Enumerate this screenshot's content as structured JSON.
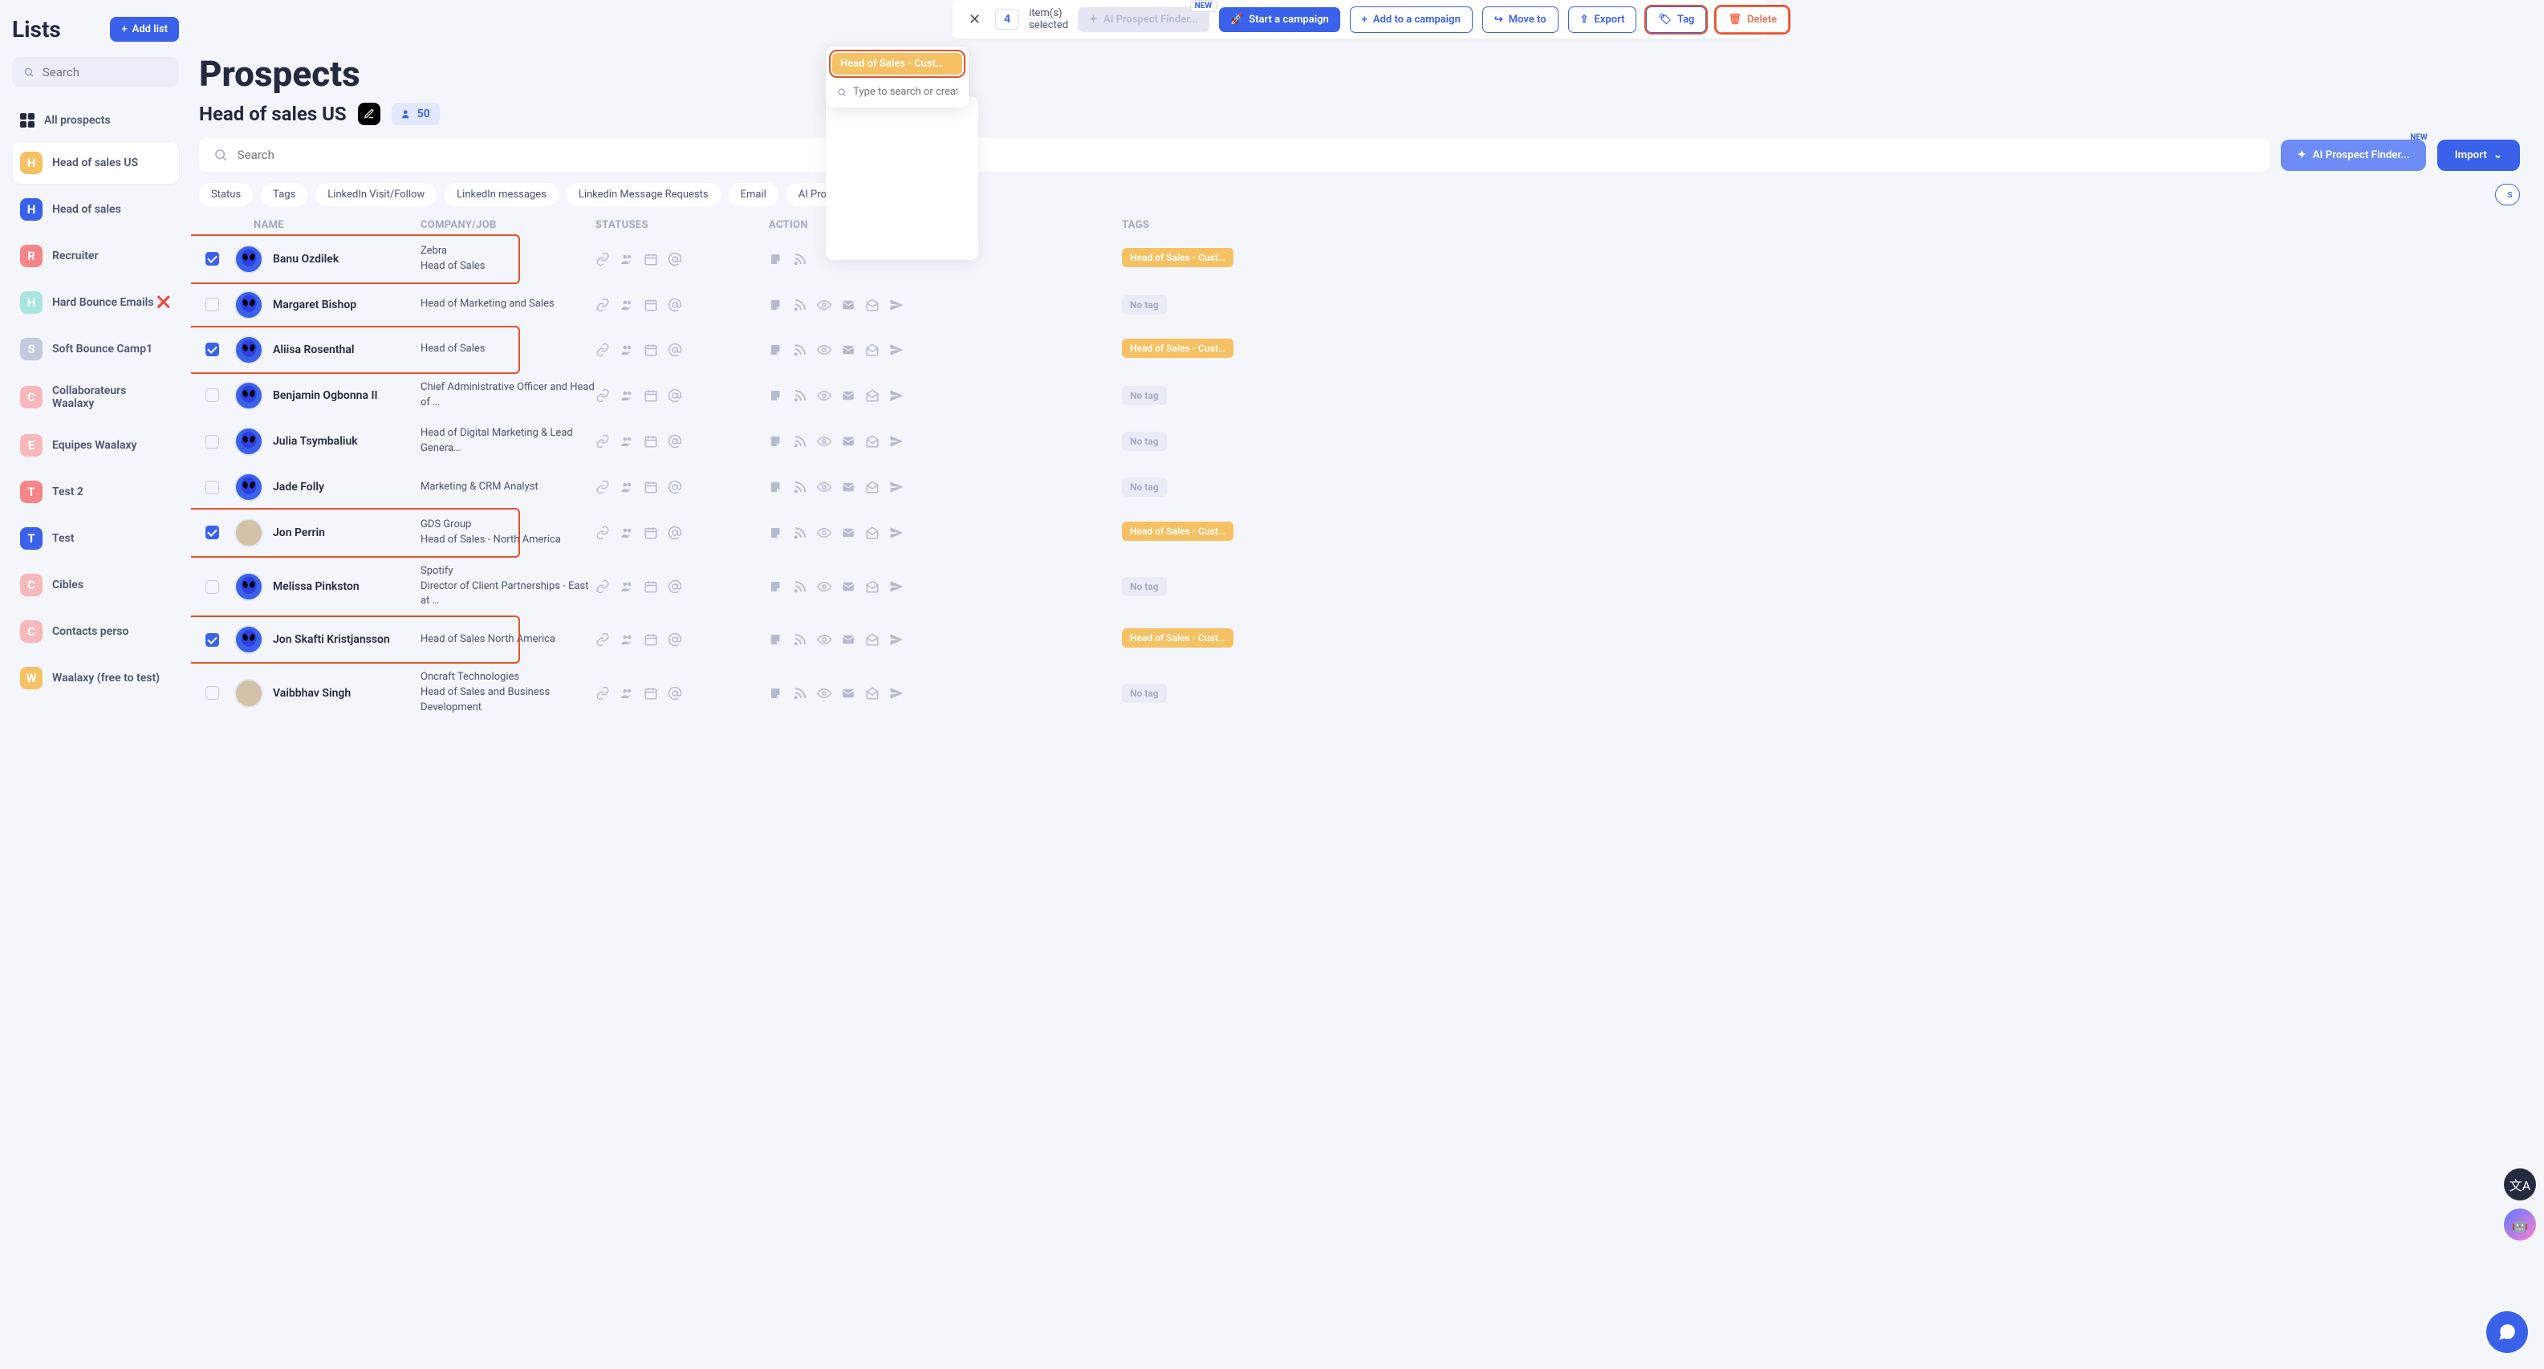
{
  "sidebar": {
    "title": "Lists",
    "add_list": "Add list",
    "search_placeholder": "Search",
    "all_prospects": "All prospects",
    "items": [
      {
        "letter": "H",
        "label": "Head of sales US",
        "color": "c-yellow",
        "active": true
      },
      {
        "letter": "H",
        "label": "Head of sales",
        "color": "c-blue"
      },
      {
        "letter": "R",
        "label": "Recruiter",
        "color": "c-red"
      },
      {
        "letter": "H",
        "label": "Hard Bounce Emails ❌",
        "color": "c-teal"
      },
      {
        "letter": "S",
        "label": "Soft Bounce Camp1",
        "color": "c-grey"
      },
      {
        "letter": "C",
        "label": "Collaborateurs Waalaxy",
        "color": "c-pink"
      },
      {
        "letter": "E",
        "label": "Equipes Waalaxy",
        "color": "c-pink"
      },
      {
        "letter": "T",
        "label": "Test 2",
        "color": "c-red"
      },
      {
        "letter": "T",
        "label": "Test",
        "color": "c-blue"
      },
      {
        "letter": "C",
        "label": "Cibles",
        "color": "c-pink"
      },
      {
        "letter": "C",
        "label": "Contacts perso",
        "color": "c-pink"
      },
      {
        "letter": "W",
        "label": "Waalaxy (free to test)",
        "color": "c-yellow"
      }
    ]
  },
  "top_bar": {
    "count": "4",
    "selected_text": "item(s) selected",
    "ai_prospect": "AI Prospect Finder...",
    "new_badge": "NEW",
    "start_campaign": "Start a campaign",
    "add_campaign": "Add to a campaign",
    "move_to": "Move to",
    "export": "Export",
    "tag": "Tag",
    "delete": "Delete"
  },
  "tag_popover": {
    "selected_tag": "Head of Sales - Cust…",
    "search_placeholder": "Type to search or create a"
  },
  "page": {
    "title": "Prospects",
    "list_name": "Head of sales US",
    "count": "50",
    "search_placeholder": "Search",
    "ai_finder": "AI Prospect Finder...",
    "new_badge": "NEW",
    "import": "Import",
    "filters": [
      "Status",
      "Tags",
      "LinkedIn Visit/Follow",
      "LinkedIn messages",
      "Linkedin Message Requests",
      "Email",
      "AI Prospect Finder"
    ],
    "filters_suffix_chip": "s"
  },
  "table": {
    "headers": {
      "name": "NAME",
      "company": "COMPANY/JOB",
      "statuses": "STATUSES",
      "actions": "ACTION",
      "tags": "TAGS"
    },
    "rows": [
      {
        "checked": true,
        "highlight": true,
        "name": "Banu Ozdilek",
        "company": "Zebra",
        "job": "Head of Sales",
        "tag": "Head of Sales - Cust…",
        "actions": "short"
      },
      {
        "checked": false,
        "name": "Margaret Bishop",
        "job": "Head of Marketing and Sales",
        "no_tag": "No tag",
        "actions": "full"
      },
      {
        "checked": true,
        "highlight": true,
        "name": "Aliisa Rosenthal",
        "job": "Head of Sales",
        "tag": "Head of Sales - Cust…",
        "actions": "full"
      },
      {
        "checked": false,
        "name": "Benjamin Ogbonna II",
        "job": "Chief Administrative Officer and Head of …",
        "no_tag": "No tag",
        "actions": "full"
      },
      {
        "checked": false,
        "name": "Julia Tsymbaliuk",
        "job": "Head of Digital Marketing & Lead Genera…",
        "no_tag": "No tag",
        "actions": "full"
      },
      {
        "checked": false,
        "name": "Jade Folly",
        "job": "Marketing & CRM Analyst",
        "no_tag": "No tag",
        "actions": "full"
      },
      {
        "checked": true,
        "highlight": true,
        "photo": true,
        "name": "Jon Perrin",
        "company": "GDS Group",
        "job": "Head of Sales - North America",
        "tag": "Head of Sales - Cust…",
        "actions": "full"
      },
      {
        "checked": false,
        "name": "Melissa Pinkston",
        "company": "Spotify",
        "job": "Director of Client Partnerships - East at …",
        "no_tag": "No tag",
        "actions": "full"
      },
      {
        "checked": true,
        "highlight": true,
        "name": "Jon Skafti Kristjansson",
        "job": "Head of Sales North America",
        "tag": "Head of Sales - Cust…",
        "actions": "full"
      },
      {
        "checked": false,
        "photo": true,
        "name": "Vaibbhav Singh",
        "company": "Oncraft Technologies",
        "job": "Head of Sales and Business Development",
        "no_tag": "No tag",
        "actions": "full"
      }
    ]
  }
}
